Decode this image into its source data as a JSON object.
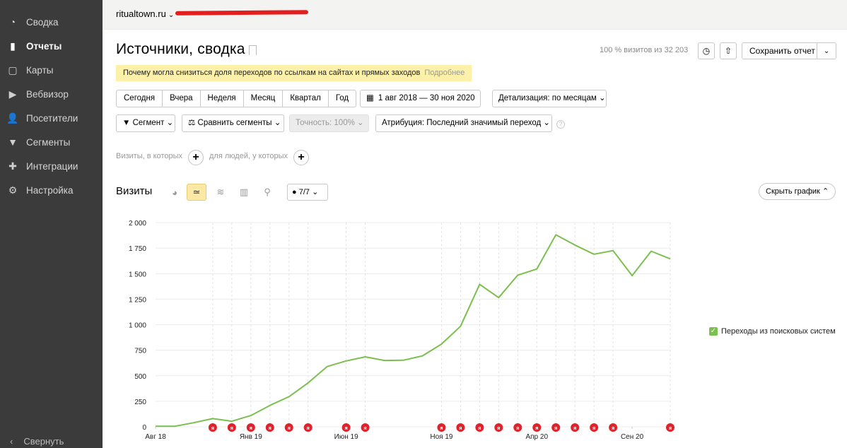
{
  "sidebar": {
    "items": [
      {
        "label": "Сводка",
        "icon": "dashboard-icon",
        "glyph": "◔",
        "active": false
      },
      {
        "label": "Отчеты",
        "icon": "bar-chart-icon",
        "glyph": "▮",
        "active": true
      },
      {
        "label": "Карты",
        "icon": "map-icon",
        "glyph": "▢",
        "active": false
      },
      {
        "label": "Вебвизор",
        "icon": "play-icon",
        "glyph": "▶",
        "active": false
      },
      {
        "label": "Посетители",
        "icon": "user-icon",
        "glyph": "👤",
        "active": false
      },
      {
        "label": "Сегменты",
        "icon": "filter-icon",
        "glyph": "▼",
        "active": false
      },
      {
        "label": "Интеграции",
        "icon": "puzzle-icon",
        "glyph": "✚",
        "active": false
      },
      {
        "label": "Настройка",
        "icon": "gear-icon",
        "glyph": "⚙",
        "active": false
      }
    ],
    "collapse_label": "Свернуть"
  },
  "topbar": {
    "site": "ritualtown.ru"
  },
  "header": {
    "title": "Источники, сводка",
    "visits_share": "100 % визитов из 32 203",
    "save_label": "Сохранить отчет"
  },
  "notice": {
    "text": "Почему могла снизиться доля переходов по ссылкам на сайтах и прямых заходов",
    "more": "Подробнее"
  },
  "periods": [
    "Сегодня",
    "Вчера",
    "Неделя",
    "Месяц",
    "Квартал",
    "Год"
  ],
  "date_range": "1 авг 2018 — 30 ноя 2020",
  "detail": "Детализация: по месяцам",
  "filters": {
    "segment": "Сегмент",
    "compare": "Сравнить сегменты",
    "accuracy": "Точность: 100%",
    "attribution": "Атрибуция: Последний значимый переход"
  },
  "conditions": {
    "visits": "Визиты, в которых",
    "people": "для людей, у которых"
  },
  "chart_header": {
    "title": "Визиты",
    "series_count": "7/7",
    "hide_label": "Скрыть график"
  },
  "chart_data": {
    "type": "line",
    "title": "Визиты",
    "x": [
      "2018-08",
      "2018-09",
      "2018-10",
      "2018-11",
      "2018-12",
      "2019-01",
      "2019-02",
      "2019-03",
      "2019-04",
      "2019-05",
      "2019-06",
      "2019-07",
      "2019-08",
      "2019-09",
      "2019-10",
      "2019-11",
      "2019-12",
      "2020-01",
      "2020-02",
      "2020-03",
      "2020-04",
      "2020-05",
      "2020-06",
      "2020-07",
      "2020-08",
      "2020-09",
      "2020-10",
      "2020-11"
    ],
    "xticks": [
      {
        "at": "2018-08",
        "label": "Авг 18"
      },
      {
        "at": "2019-01",
        "label": "Янв 19"
      },
      {
        "at": "2019-06",
        "label": "Июн 19"
      },
      {
        "at": "2019-11",
        "label": "Ноя 19"
      },
      {
        "at": "2020-04",
        "label": "Апр 20"
      },
      {
        "at": "2020-09",
        "label": "Сен 20"
      }
    ],
    "ylim": [
      0,
      2000
    ],
    "yticks": [
      "0",
      "250",
      "500",
      "750",
      "1 000",
      "1 250",
      "1 500",
      "1 750",
      "2 000"
    ],
    "series": [
      {
        "name": "Переходы из поисковых систем",
        "color": "#7bbf4e",
        "values": [
          5,
          5,
          40,
          80,
          55,
          110,
          210,
          295,
          430,
          590,
          645,
          685,
          650,
          652,
          695,
          810,
          985,
          1395,
          1265,
          1485,
          1545,
          1880,
          1780,
          1690,
          1725,
          1480,
          1720,
          1645
        ]
      }
    ],
    "grid": true,
    "legend": "right",
    "annotation_months": [
      "2018-11",
      "2018-12",
      "2019-01",
      "2019-02",
      "2019-03",
      "2019-04",
      "2019-06",
      "2019-07",
      "2019-11",
      "2019-12",
      "2020-01",
      "2020-02",
      "2020-03",
      "2020-04",
      "2020-05",
      "2020-06",
      "2020-07",
      "2020-08",
      "2020-11"
    ]
  }
}
